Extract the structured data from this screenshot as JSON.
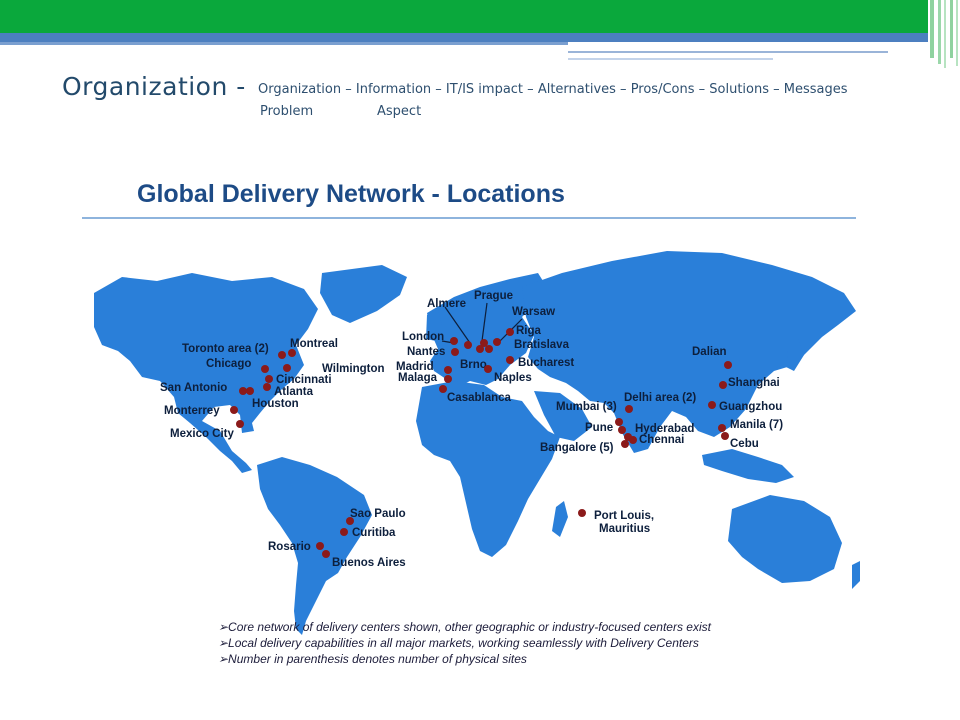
{
  "slide": {
    "title": "Organization -",
    "nav": [
      {
        "label": "Organization –"
      },
      {
        "label": "Information –"
      },
      {
        "label": "IT/IS impact –"
      },
      {
        "label": "Alternatives –"
      },
      {
        "label": "Pros/Cons –"
      },
      {
        "label": "Solutions –"
      },
      {
        "label": "Messages"
      }
    ],
    "nav_sub": [
      "Problem",
      "Aspect"
    ],
    "colors": {
      "green": "#0aa83c",
      "blue": "#4c7fc0",
      "title": "#234a6b"
    }
  },
  "figure": {
    "title": "Global Delivery Network - Locations",
    "colors": {
      "land": "#2a7fd9",
      "pin": "#8b1a1a",
      "title": "#1d4b86"
    },
    "locations": [
      {
        "name": "Toronto area (2)"
      },
      {
        "name": "Montreal"
      },
      {
        "name": "Chicago"
      },
      {
        "name": "Wilmington"
      },
      {
        "name": "Cincinnati"
      },
      {
        "name": "Atlanta"
      },
      {
        "name": "San Antonio"
      },
      {
        "name": "Houston"
      },
      {
        "name": "Monterrey"
      },
      {
        "name": "Mexico City"
      },
      {
        "name": "Sao Paulo"
      },
      {
        "name": "Curitiba"
      },
      {
        "name": "Rosario"
      },
      {
        "name": "Buenos Aires"
      },
      {
        "name": "Almere"
      },
      {
        "name": "Prague"
      },
      {
        "name": "Warsaw"
      },
      {
        "name": "London"
      },
      {
        "name": "Riga"
      },
      {
        "name": "Nantes"
      },
      {
        "name": "Bratislava"
      },
      {
        "name": "Brno"
      },
      {
        "name": "Madrid"
      },
      {
        "name": "Bucharest"
      },
      {
        "name": "Malaga"
      },
      {
        "name": "Naples"
      },
      {
        "name": "Casablanca"
      },
      {
        "name": "Dalian"
      },
      {
        "name": "Shanghai"
      },
      {
        "name": "Mumbai (3)"
      },
      {
        "name": "Delhi area (2)"
      },
      {
        "name": "Guangzhou"
      },
      {
        "name": "Pune"
      },
      {
        "name": "Hyderabad"
      },
      {
        "name": "Manila (7)"
      },
      {
        "name": "Chennai"
      },
      {
        "name": "Bangalore (5)"
      },
      {
        "name": "Cebu"
      },
      {
        "name": "Port Louis,"
      },
      {
        "name": "Mauritius"
      }
    ],
    "notes": [
      "➢Core network of delivery centers shown, other geographic or industry-focused centers exist",
      "➢Local delivery capabilities in all major markets, working seamlessly with Delivery Centers",
      "➢Number in parenthesis denotes number of physical sites"
    ]
  }
}
